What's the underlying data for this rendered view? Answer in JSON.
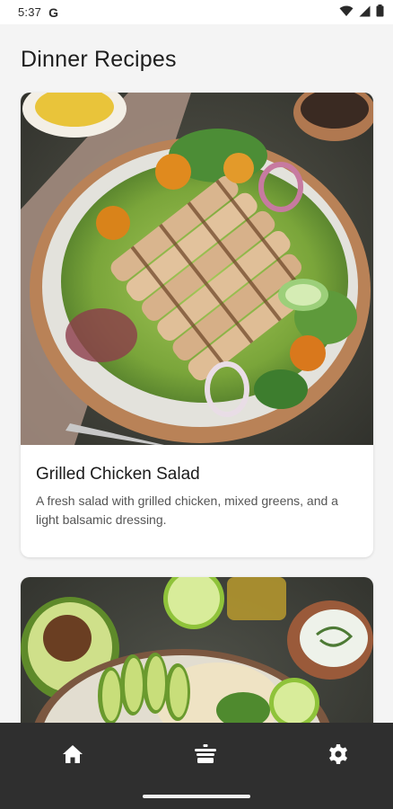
{
  "status_bar": {
    "time": "5:37",
    "google_badge": "G",
    "icons": [
      "wifi-icon",
      "signal-icon",
      "battery-icon"
    ]
  },
  "header": {
    "title": "Dinner Recipes"
  },
  "recipes": [
    {
      "title": "Grilled Chicken Salad",
      "description": "A fresh salad with grilled chicken, mixed greens, and a light balsamic dressing.",
      "image": "grilled-chicken-salad-photo"
    },
    {
      "title": "",
      "description": "",
      "image": "avocado-quinoa-bowl-photo"
    }
  ],
  "bottom_nav": {
    "items": [
      {
        "icon": "home-icon"
      },
      {
        "icon": "recipes-icon"
      },
      {
        "icon": "settings-icon"
      }
    ]
  },
  "colors": {
    "background": "#f4f4f4",
    "nav_background": "#2f2f2f",
    "card_background": "#ffffff",
    "title_text": "#1e1e1e"
  }
}
